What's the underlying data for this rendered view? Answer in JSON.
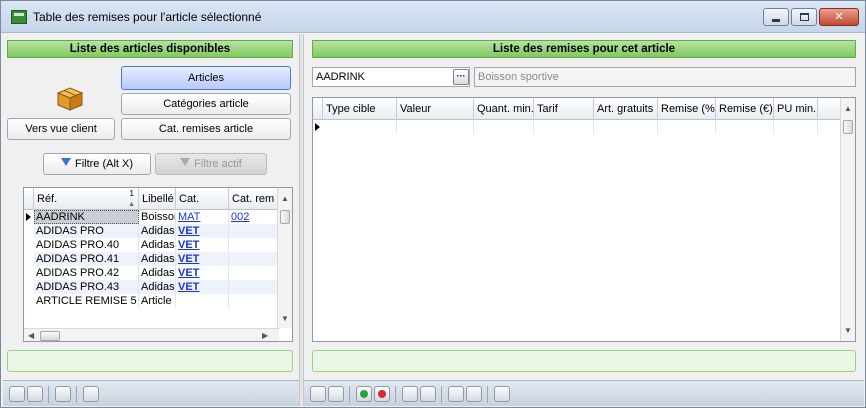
{
  "window": {
    "title": "Table des remises pour l'article sélectionné",
    "min_glyph": "",
    "max_glyph": "",
    "close_glyph": "✕"
  },
  "left": {
    "header": "Liste des articles disponibles",
    "buttons": {
      "articles": "Articles",
      "categories": "Catégories article",
      "client_view": "Vers vue client",
      "cat_remises": "Cat. remises article",
      "filter": "Filtre (Alt X)",
      "filter_active": "Filtre actif"
    },
    "table": {
      "columns": [
        "Réf.",
        "Libellé",
        "Cat.",
        "Cat. rem"
      ],
      "sort_indicator": "1",
      "rows": [
        {
          "ref": "AADRINK",
          "libelle": "Boisson",
          "cat": "MAT",
          "cat_rem": "002"
        },
        {
          "ref": "ADIDAS PRO",
          "libelle": "Adidas",
          "cat": "VET",
          "cat_rem": ""
        },
        {
          "ref": "ADIDAS PRO.40",
          "libelle": "Adidas",
          "cat": "VET",
          "cat_rem": ""
        },
        {
          "ref": "ADIDAS PRO.41",
          "libelle": "Adidas",
          "cat": "VET",
          "cat_rem": ""
        },
        {
          "ref": "ADIDAS PRO.42",
          "libelle": "Adidas",
          "cat": "VET",
          "cat_rem": ""
        },
        {
          "ref": "ADIDAS PRO.43",
          "libelle": "Adidas",
          "cat": "VET",
          "cat_rem": ""
        },
        {
          "ref": "ARTICLE REMISE 5",
          "libelle": "Article",
          "cat": "",
          "cat_rem": ""
        }
      ]
    }
  },
  "right": {
    "header": "Liste des remises pour cet article",
    "article_code": "AADRINK",
    "ellipsis": "···",
    "article_label": "Boisson sportive",
    "table": {
      "columns": [
        "Type cible",
        "Valeur",
        "Quant. min.",
        "Tarif",
        "Art. gratuits",
        "Remise (%)",
        "Remise (€)",
        "PU min."
      ]
    }
  },
  "colors": {
    "header_green": "#7fca5f",
    "link_blue": "#1a35d8",
    "status_green": "#eaf6e4"
  }
}
